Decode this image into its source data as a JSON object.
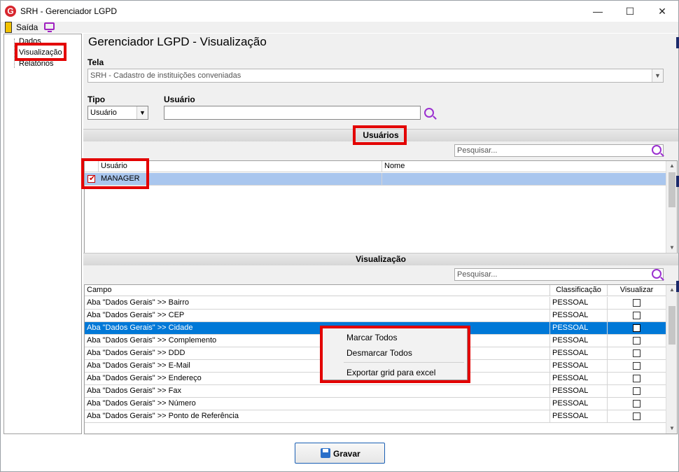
{
  "window": {
    "title": "SRH - Gerenciador LGPD",
    "icon_letter": "G",
    "minimize": "—",
    "maximize": "☐",
    "close": "✕"
  },
  "menu": {
    "exit_label": "Saída"
  },
  "tree": {
    "items": [
      {
        "label": "Dados"
      },
      {
        "label": "Visualização"
      },
      {
        "label": "Relatórios"
      }
    ]
  },
  "main": {
    "title": "Gerenciador LGPD - Visualização",
    "tela_label": "Tela",
    "tela_value": "SRH - Cadastro de instituições conveniadas",
    "tipo_label": "Tipo",
    "tipo_value": "Usuário",
    "usuario_label": "Usuário",
    "usuario_value": ""
  },
  "users_section": {
    "title": "Usuários",
    "search_placeholder": "Pesquisar...",
    "columns": [
      "Usuário",
      "Nome"
    ],
    "rows": [
      {
        "usuario": "MANAGER",
        "nome": "",
        "checked": true
      }
    ]
  },
  "view_section": {
    "title": "Visualização",
    "search_placeholder": "Pesquisar...",
    "columns": [
      "Campo",
      "Classificação",
      "Visualizar"
    ],
    "rows": [
      {
        "campo": "Aba \"Dados Gerais\" >> Bairro",
        "classificacao": "PESSOAL"
      },
      {
        "campo": "Aba \"Dados Gerais\" >> CEP",
        "classificacao": "PESSOAL"
      },
      {
        "campo": "Aba \"Dados Gerais\" >> Cidade",
        "classificacao": "PESSOAL"
      },
      {
        "campo": "Aba \"Dados Gerais\" >> Complemento",
        "classificacao": "PESSOAL"
      },
      {
        "campo": "Aba \"Dados Gerais\" >> DDD",
        "classificacao": "PESSOAL"
      },
      {
        "campo": "Aba \"Dados Gerais\" >> E-Mail",
        "classificacao": "PESSOAL"
      },
      {
        "campo": "Aba \"Dados Gerais\" >> Endereço",
        "classificacao": "PESSOAL"
      },
      {
        "campo": "Aba \"Dados Gerais\" >> Fax",
        "classificacao": "PESSOAL"
      },
      {
        "campo": "Aba \"Dados Gerais\" >> Número",
        "classificacao": "PESSOAL"
      },
      {
        "campo": "Aba \"Dados Gerais\" >> Ponto de Referência",
        "classificacao": "PESSOAL"
      }
    ],
    "selected_row": "Aba \"Dados Gerais\" >> Cidade"
  },
  "context_menu": {
    "items": [
      "Marcar Todos",
      "Desmarcar Todos",
      "Exportar grid para excel"
    ]
  },
  "footer": {
    "save_label": "Gravar"
  },
  "colors": {
    "highlight": "#e30000",
    "selection_blue": "#0078d7",
    "user_row": "#a9c6ee"
  }
}
